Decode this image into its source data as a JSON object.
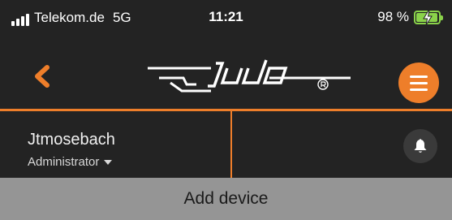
{
  "status_bar": {
    "carrier": "Telekom.de",
    "network": "5G",
    "time": "11:21",
    "battery_percent": "98 %",
    "battery_level": 0.98,
    "battery_color": "#8ad24a",
    "signal_icon": "signal-bars-icon",
    "battery_icon": "battery-charging-icon"
  },
  "nav": {
    "back_icon": "chevron-left-icon",
    "logo_text": "judo®",
    "menu_icon": "hamburger-menu-icon"
  },
  "user": {
    "name": "Jtmosebach",
    "role": "Administrator",
    "role_icon": "caret-down-icon"
  },
  "notifications": {
    "icon": "bell-icon"
  },
  "actions": {
    "add_device_label": "Add device"
  },
  "colors": {
    "accent": "#ee7e2a",
    "background": "#232323",
    "add_bar": "#959595"
  }
}
